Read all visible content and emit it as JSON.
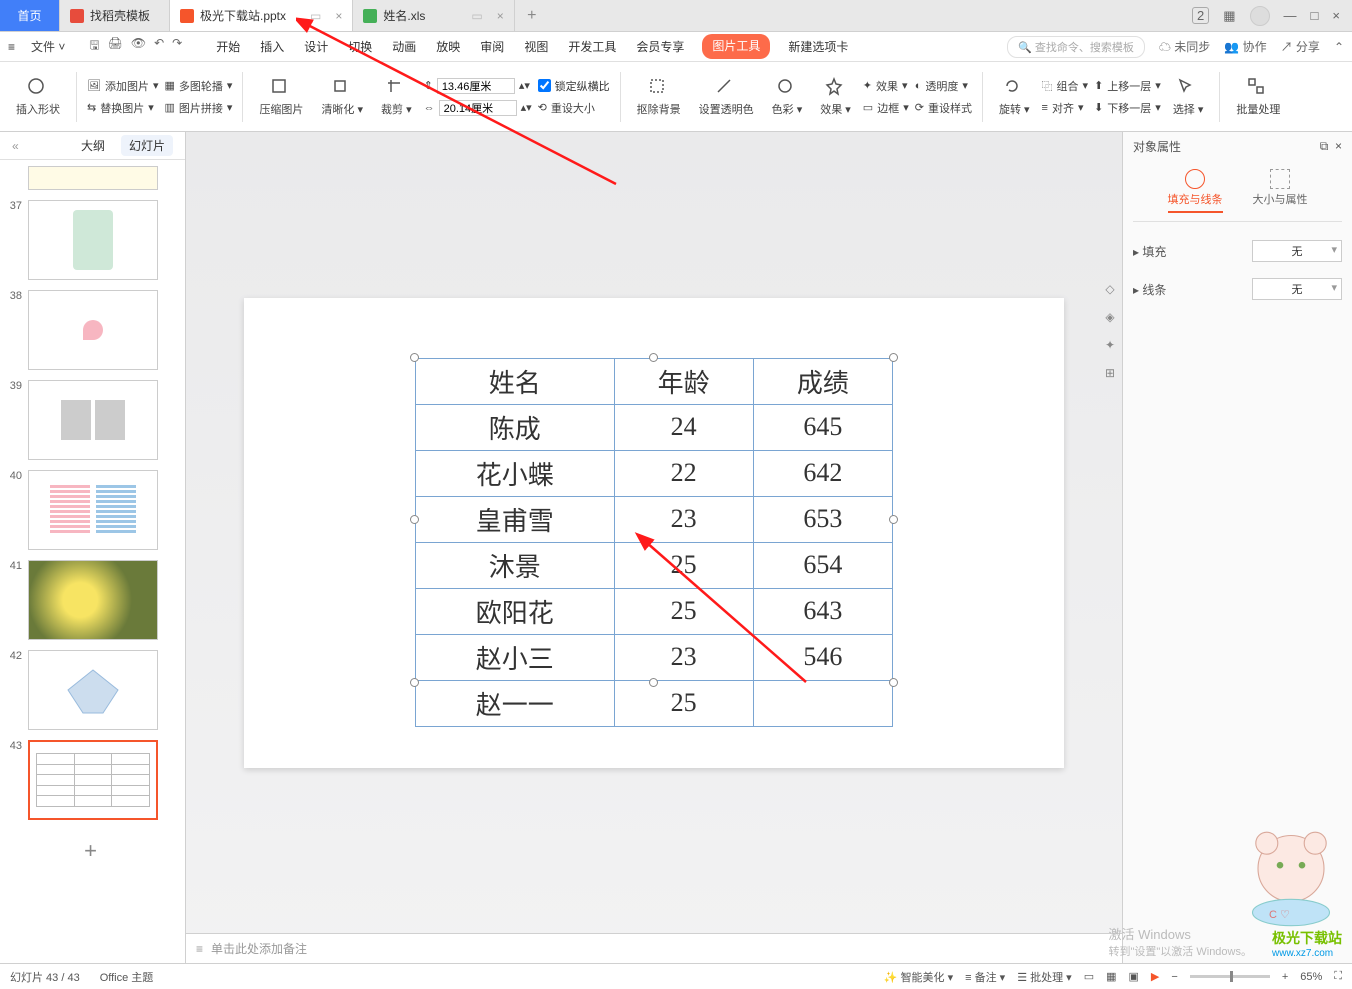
{
  "tabs": {
    "home": "首页",
    "t1": "找稻壳模板",
    "t2": "极光下载站.pptx",
    "t3": "姓名.xls"
  },
  "winControls": {
    "count": "2"
  },
  "fileMenu": "文件",
  "menuTabs": [
    "开始",
    "插入",
    "设计",
    "切换",
    "动画",
    "放映",
    "审阅",
    "视图",
    "开发工具",
    "会员专享"
  ],
  "menuPill": "图片工具",
  "menuExtra": "新建选项卡",
  "searchHint": "查找命令、搜索模板",
  "topRight": {
    "sync": "未同步",
    "collab": "协作",
    "share": "分享"
  },
  "ribbon": {
    "insertShape": "插入形状",
    "addImage": "添加图片",
    "replaceImage": "替换图片",
    "multiOutline": "多图轮播",
    "imageStitch": "图片拼接",
    "compress": "压缩图片",
    "clarify": "清晰化",
    "crop": "裁剪",
    "h": "13.46厘米",
    "w": "20.14厘米",
    "lockRatio": "锁定纵横比",
    "resetSize": "重设大小",
    "removeBg": "抠除背景",
    "setTransparent": "设置透明色",
    "colorify": "色彩",
    "effect": "效果",
    "transparency": "透明度",
    "border": "边框",
    "resetStyle": "重设样式",
    "rotate": "旋转",
    "align": "对齐",
    "group": "组合",
    "bringFwd": "上移一层",
    "sendBack": "下移一层",
    "select": "选择",
    "batch": "批量处理"
  },
  "outline": {
    "tab1": "大纲",
    "tab2": "幻灯片"
  },
  "thumbs": [
    37,
    38,
    39,
    40,
    41,
    42,
    43
  ],
  "chart_data": {
    "type": "table",
    "headers": [
      "姓名",
      "年龄",
      "成绩"
    ],
    "rows": [
      [
        "陈成",
        "24",
        "645"
      ],
      [
        "花小蝶",
        "22",
        "642"
      ],
      [
        "皇甫雪",
        "23",
        "653"
      ],
      [
        "沐景",
        "25",
        "654"
      ],
      [
        "欧阳花",
        "25",
        "643"
      ],
      [
        "赵小三",
        "23",
        "546"
      ],
      [
        "赵一一",
        "25",
        ""
      ]
    ]
  },
  "notesPlaceholder": "单击此处添加备注",
  "prop": {
    "title": "对象属性",
    "tab1": "填充与线条",
    "tab2": "大小与属性",
    "fill": "填充",
    "line": "线条",
    "none": "无"
  },
  "status": {
    "pos": "幻灯片 43 / 43",
    "theme": "Office 主题",
    "beautify": "智能美化",
    "notes": "备注",
    "batch": "批处理",
    "zoom": "65%"
  },
  "activate": {
    "l1": "激活 Windows",
    "l2": "转到\"设置\"以激活 Windows。"
  },
  "watermark": {
    "t1": "极光下载站",
    "t2": "www.xz7.com"
  }
}
